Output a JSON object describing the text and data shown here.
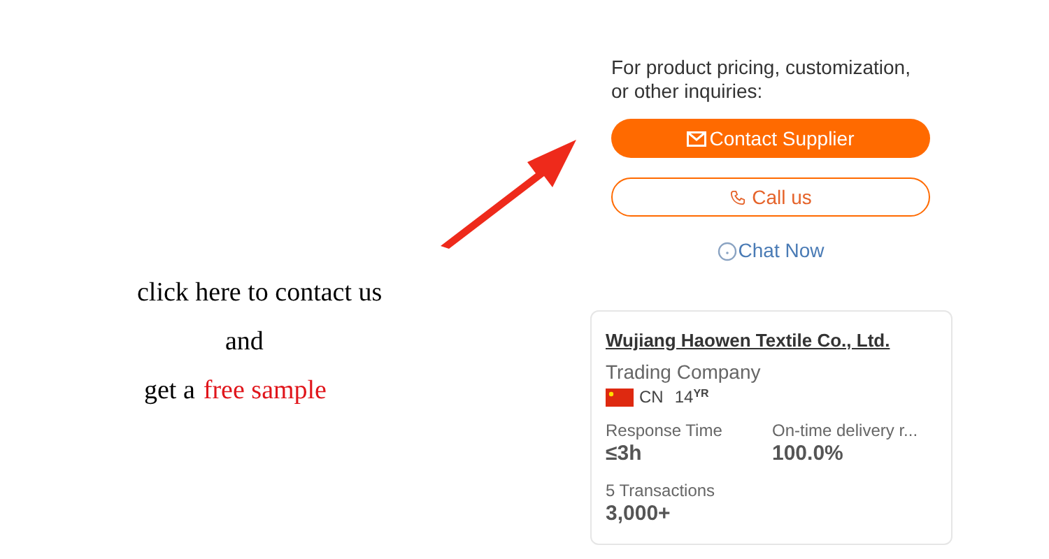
{
  "note": {
    "lines": [
      {
        "segments": [
          {
            "text": "click here to contact us",
            "highlight": false
          }
        ]
      },
      {
        "segments": [
          {
            "text": "and",
            "highlight": false
          }
        ]
      },
      {
        "segments": [
          {
            "text": "get a",
            "highlight": false
          },
          {
            "text": "free sample",
            "highlight": true
          }
        ]
      }
    ]
  },
  "contact": {
    "prompt": "For product pricing, customization, or other inquiries:",
    "primary_button": "Contact Supplier",
    "call_button": "Call us",
    "chat_link": "Chat Now"
  },
  "supplier": {
    "name": "Wujiang Haowen Textile Co., Ltd.",
    "type": "Trading Company",
    "country": "CN",
    "years": "14",
    "years_unit": "YR",
    "stats": [
      {
        "label": "Response Time",
        "value": "≤3h"
      },
      {
        "label": "On-time delivery r...",
        "value": "100.0%"
      },
      {
        "label": "5 Transactions",
        "value": "3,000+"
      }
    ]
  }
}
